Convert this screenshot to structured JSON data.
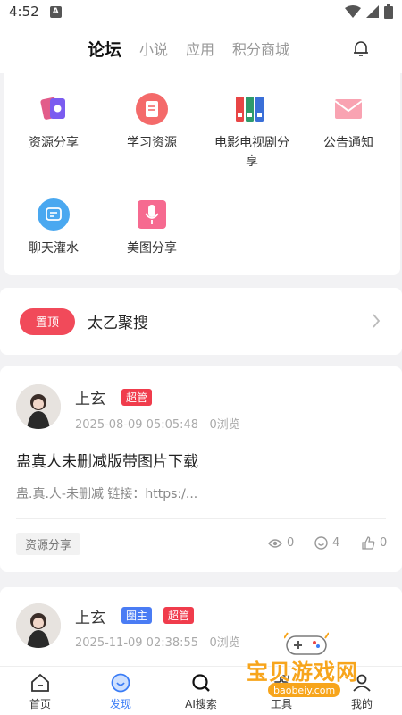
{
  "status_bar": {
    "time": "4:52",
    "notification_letter": "A"
  },
  "top_nav": {
    "tabs": [
      {
        "label": "论坛",
        "active": true
      },
      {
        "label": "小说",
        "active": false
      },
      {
        "label": "应用",
        "active": false
      },
      {
        "label": "积分商城",
        "active": false
      }
    ],
    "bell_icon": "bell-icon"
  },
  "categories": [
    {
      "label": "资源分享",
      "icon": "cards-icon",
      "color": "#7b5cf0"
    },
    {
      "label": "学习资源",
      "icon": "document-icon",
      "color": "#f46a6a"
    },
    {
      "label": "电影电视剧分享",
      "icon": "binders-icon",
      "color": "#e84545"
    },
    {
      "label": "公告通知",
      "icon": "mail-icon",
      "color": "#f6899a"
    },
    {
      "label": "聊天灌水",
      "icon": "chat-icon",
      "color": "#4aa8f0"
    },
    {
      "label": "美图分享",
      "icon": "microphone-icon",
      "color": "#f66a90"
    }
  ],
  "pinned": {
    "badge": "置顶",
    "title": "太乙聚搜"
  },
  "posts": [
    {
      "author": "上玄",
      "badges": [
        "超管"
      ],
      "date": "2025-08-09 05:05:48",
      "views": "0浏览",
      "title": "蛊真人未删减版带图片下载",
      "excerpt": "蛊.真.人-未删减 链接：https:/...",
      "tag": "资源分享",
      "stats": {
        "views": "0",
        "likes": "4",
        "thumbs": "0"
      }
    },
    {
      "author": "上玄",
      "badges": [
        "圈主",
        "超管"
      ],
      "date": "2025-11-09 02:38:55",
      "views": "0浏览"
    }
  ],
  "bottom_nav": [
    {
      "label": "首页",
      "icon": "home-icon",
      "active": false
    },
    {
      "label": "发现",
      "icon": "discover-icon",
      "active": true
    },
    {
      "label": "AI搜索",
      "icon": "search-icon",
      "active": false
    },
    {
      "label": "工具",
      "icon": "tools-icon",
      "active": false
    },
    {
      "label": "我的",
      "icon": "profile-icon",
      "active": false
    }
  ],
  "watermark": {
    "text": "宝贝游戏网",
    "url": "baobeiy.com"
  },
  "colors": {
    "accent": "#3a7cf6",
    "pin": "#f14a5a",
    "admin_badge": "#f03c4c",
    "owner_badge": "#4a7cf4"
  }
}
